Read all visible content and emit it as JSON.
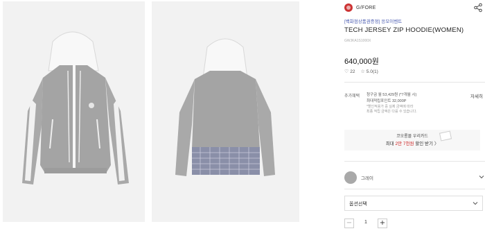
{
  "gallery": {
    "front_image": "hoodie-front-photo",
    "back_image": "hoodie-back-photo"
  },
  "brand": {
    "name": "G/FORE",
    "logo_color": "#cc3333",
    "share_icon": "share-icon"
  },
  "product": {
    "promo": "[백화점상품권증정] 응모이벤트",
    "title": "TECH JERSEY ZIP HOODIE(WOMEN)",
    "code": "GWJKA1S1000X",
    "price": "640,000원",
    "likes": "22",
    "rating": "5.0(1)"
  },
  "benefit": {
    "label": "추가혜택",
    "more": "자세히",
    "line1": "청구금 월 53,429원 (*7개월 시)",
    "line2": "최대적립포인트 32,000P",
    "note1": "*할인적용가 중 실제 금액에 따라",
    "note2": "최종 적립 금액은 다를 수 있습니다."
  },
  "coupon": {
    "line1": "코오롱몰 우리카드",
    "line2_prefix": "최대 ",
    "line2_highlight": "2만 7천원",
    "line2_suffix": " 할인 받기",
    "arrow": "〉"
  },
  "color": {
    "name": "그레이",
    "swatch": "#a9a9a9"
  },
  "option": {
    "label": "옵션선택"
  },
  "quantity": {
    "minus": "−",
    "value": "1",
    "plus": "+"
  }
}
